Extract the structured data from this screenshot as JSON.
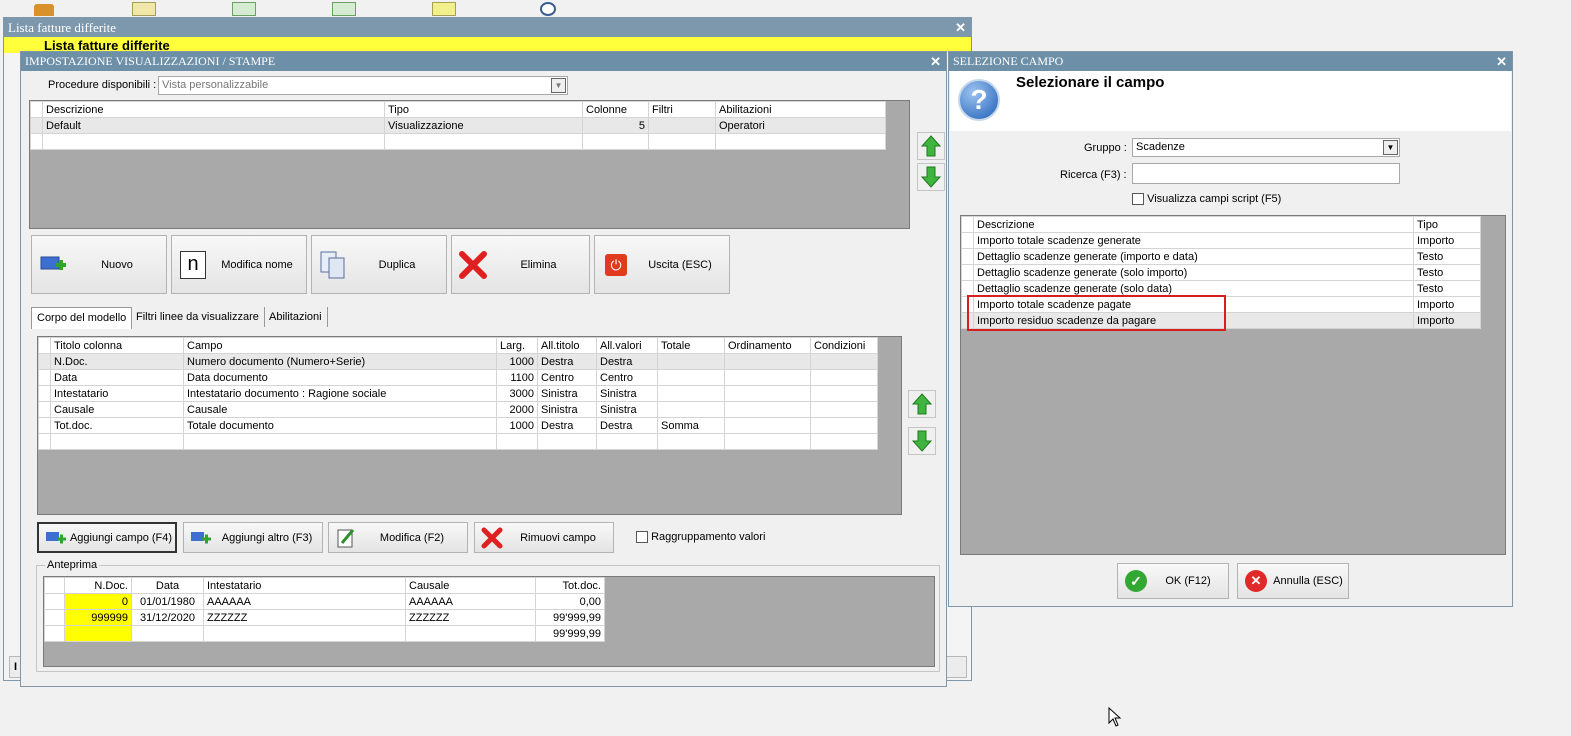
{
  "bg_window": {
    "title": "Lista fatture differite",
    "subtitle": "Lista fatture differite",
    "status_char": "I"
  },
  "main_window": {
    "title": "IMPOSTAZIONE VISUALIZZAZIONI / STAMPE",
    "procedure_label": "Procedure disponibili :",
    "procedure_value": "Vista personalizzabile",
    "models_table": {
      "headers": [
        "Descrizione",
        "Tipo",
        "Colonne",
        "Filtri",
        "Abilitazioni"
      ],
      "rows": [
        [
          "Default",
          "Visualizzazione",
          "5",
          "",
          "Operatori"
        ]
      ]
    },
    "buttons": {
      "new": "Nuovo",
      "rename": "Modifica nome",
      "duplicate": "Duplica",
      "delete": "Elimina",
      "exit": "Uscita (ESC)"
    },
    "tabs": [
      "Corpo del modello",
      "Filtri linee da visualizzare",
      "Abilitazioni"
    ],
    "columns_table": {
      "headers": [
        "Titolo colonna",
        "Campo",
        "Larg.",
        "All.titolo",
        "All.valori",
        "Totale",
        "Ordinamento",
        "Condizioni"
      ],
      "rows": [
        [
          "N.Doc.",
          "Numero documento (Numero+Serie)",
          "1000",
          "Destra",
          "Destra",
          "",
          "",
          ""
        ],
        [
          "Data",
          "Data documento",
          "1100",
          "Centro",
          "Centro",
          "",
          "",
          ""
        ],
        [
          "Intestatario",
          "Intestatario documento : Ragione sociale",
          "3000",
          "Sinistra",
          "Sinistra",
          "",
          "",
          ""
        ],
        [
          "Causale",
          "Causale",
          "2000",
          "Sinistra",
          "Sinistra",
          "",
          "",
          ""
        ],
        [
          "Tot.doc.",
          "Totale documento",
          "1000",
          "Destra",
          "Destra",
          "Somma",
          "",
          ""
        ]
      ]
    },
    "bottom_buttons": {
      "add_field": "Aggiungi campo (F4)",
      "add_other": "Aggiungi altro (F3)",
      "edit": "Modifica (F2)",
      "remove": "Rimuovi campo"
    },
    "grouping_label": "Raggruppamento valori",
    "preview": {
      "label": "Anteprima",
      "headers": [
        "N.Doc.",
        "Data",
        "Intestatario",
        "Causale",
        "Tot.doc."
      ],
      "rows": [
        [
          "0",
          "01/01/1980",
          "AAAAAA",
          "AAAAAA",
          "0,00"
        ],
        [
          "999999",
          "31/12/2020",
          "ZZZZZZ",
          "ZZZZZZ",
          "99'999,99"
        ]
      ],
      "total": "99'999,99"
    }
  },
  "field_window": {
    "title": "SELEZIONE CAMPO",
    "heading": "Selezionare il campo",
    "group_label": "Gruppo :",
    "group_value": "Scadenze",
    "search_label": "Ricerca (F3) :",
    "search_value": "",
    "script_label": "Visualizza campi script (F5)",
    "table": {
      "headers": [
        "Descrizione",
        "Tipo"
      ],
      "rows": [
        [
          "Importo totale scadenze generate",
          "Importo"
        ],
        [
          "Dettaglio scadenze generate (importo e data)",
          "Testo"
        ],
        [
          "Dettaglio scadenze generate (solo importo)",
          "Testo"
        ],
        [
          "Dettaglio scadenze generate (solo data)",
          "Testo"
        ],
        [
          "Importo totale scadenze pagate",
          "Importo"
        ],
        [
          "Importo residuo scadenze da pagare",
          "Importo"
        ]
      ]
    },
    "ok": "OK (F12)",
    "cancel": "Annulla (ESC)"
  },
  "colors": {
    "titlebar": "#6e8fa8",
    "highlight_yellow": "#ffff00",
    "selection_red": "#d81e1e",
    "grid_gray": "#a9a9a9"
  }
}
